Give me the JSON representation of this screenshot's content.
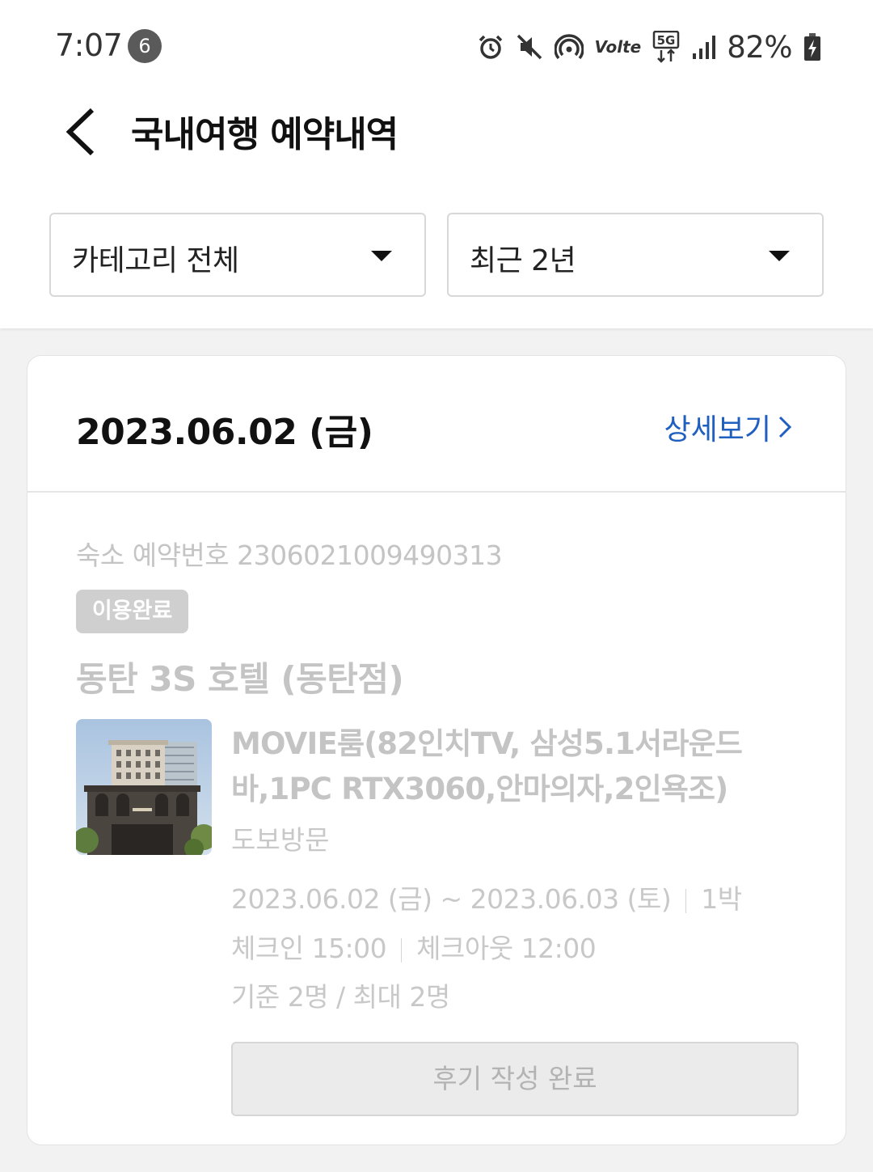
{
  "status_bar": {
    "time": "7:07",
    "notification_count": "6",
    "network_label": "5G",
    "volte_label": "Volte",
    "battery": "82%"
  },
  "header": {
    "title": "국내여행 예약내역"
  },
  "filters": {
    "category": "카테고리 전체",
    "period": "최근 2년"
  },
  "reservation": {
    "date": "2023.06.02 (금)",
    "detail_link": "상세보기",
    "reservation_number": "숙소 예약번호 2306021009490313",
    "status": "이용완료",
    "hotel_name": "동탄 3S 호텔 (동탄점)",
    "room_name": "MOVIE룸(82인치TV, 삼성5.1서라운드바,1PC RTX3060,안마의자,2인욕조)",
    "visit_type": "도보방문",
    "stay_dates": "2023.06.02 (금) ~ 2023.06.03 (토)",
    "nights": "1박",
    "check_in": "체크인 15:00",
    "check_out": "체크아웃 12:00",
    "guests": "기준 2명 / 최대 2명",
    "review_button": "후기 작성 완료"
  },
  "colors": {
    "link_blue": "#1f5fbf",
    "muted_text": "#c4c4c4",
    "badge_bg": "#cfcfcf"
  }
}
